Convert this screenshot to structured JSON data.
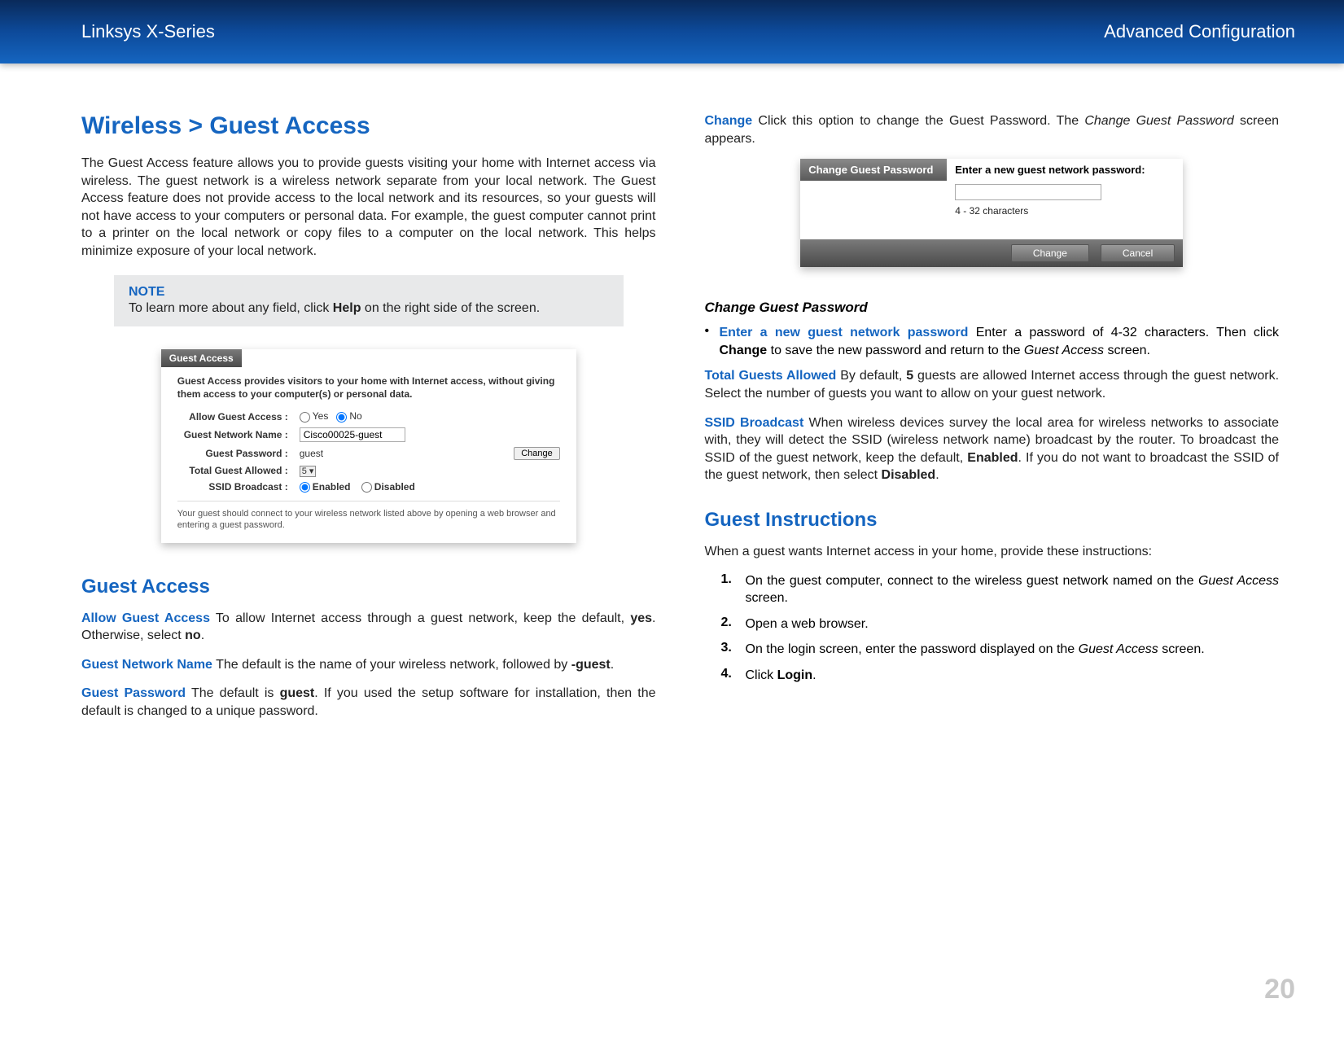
{
  "header": {
    "left": "Linksys X-Series",
    "right": "Advanced Configuration"
  },
  "left_col": {
    "h1": "Wireless > Guest Access",
    "intro": "The Guest Access feature allows you to provide guests visiting your home with Internet access via wireless. The guest network is a wireless network separate from your local network. The Guest Access feature does not provide access to the local network and its resources, so your guests will not have access to your computers or personal data. For example, the guest computer cannot print to a printer on the local network or copy files to a computer on the local network. This helps minimize exposure of your local network.",
    "note": {
      "title": "NOTE",
      "text_pre": "To learn more about any field, click ",
      "text_bold": "Help",
      "text_post": " on the right side of the screen."
    },
    "figure1": {
      "tab": "Guest Access",
      "intro": "Guest Access provides visitors to your home with Internet access, without giving them access to your computer(s) or personal data.",
      "rows": {
        "allow_label": "Allow Guest Access :",
        "allow_yes": "Yes",
        "allow_no": "No",
        "name_label": "Guest Network Name :",
        "name_value": "Cisco00025-guest",
        "pwd_label": "Guest Password :",
        "pwd_value": "guest",
        "change_btn": "Change",
        "total_label": "Total Guest Allowed :",
        "total_value": "5",
        "ssid_label": "SSID Broadcast :",
        "ssid_enabled": "Enabled",
        "ssid_disabled": "Disabled"
      },
      "footnote": "Your guest should connect to your wireless network listed above by opening a web browser and entering a guest password."
    },
    "h2": "Guest Access",
    "p_allow": {
      "term": "Allow Guest Access",
      "t1": "  To allow Internet access through a guest network, keep the default, ",
      "b1": "yes",
      "t2": ". Otherwise, select ",
      "b2": "no",
      "t3": "."
    },
    "p_name": {
      "term": "Guest Network Name",
      "t1": "  The default is the name of your wireless network, followed by ",
      "b1": "-guest",
      "t2": "."
    },
    "p_pwd": {
      "term": "Guest Password",
      "t1": "  The default is ",
      "b1": "guest",
      "t2": ". If you used the setup software for installation, then the default is changed to a unique password."
    }
  },
  "right_col": {
    "p_change": {
      "term": "Change",
      "t1": "  Click this option to change the Guest Password. The ",
      "i1": "Change Guest Password",
      "t2": " screen appears."
    },
    "dialog": {
      "title": "Change Guest Password",
      "prompt": "Enter a new guest network password:",
      "sub": "4 - 32 characters",
      "btn_change": "Change",
      "btn_cancel": "Cancel"
    },
    "subhead": "Change Guest Password",
    "bullet": {
      "term": "Enter a new guest network password",
      "t1": "   Enter a password of 4-32 characters. Then click ",
      "b1": "Change",
      "t2": " to save the new password and return to the ",
      "i1": "Guest Access",
      "t3": " screen."
    },
    "p_total": {
      "term": "Total Guests Allowed",
      "t1": "   By default, ",
      "b1": "5",
      "t2": " guests are allowed Internet access through the guest network. Select the number of guests you want to allow on your guest network."
    },
    "p_ssid": {
      "term": "SSID Broadcast",
      "t1": "  When wireless devices survey the local area for wireless networks to associate with, they will detect the SSID (wireless network name) broadcast by the router. To broadcast the SSID of the guest network, keep the default, ",
      "b1": "Enabled",
      "t2": ". If you do not want to broadcast the SSID of the guest network, then select ",
      "b2": "Disabled",
      "t3": "."
    },
    "h2": "Guest Instructions",
    "instr_intro": "When a guest wants Internet access in your home, provide these instructions:",
    "steps": {
      "s1": {
        "n": "1.",
        "t1": "On the guest computer, connect to the wireless guest network named on the ",
        "i1": "Guest Access",
        "t2": " screen."
      },
      "s2": {
        "n": "2.",
        "t1": "Open a web browser."
      },
      "s3": {
        "n": "3.",
        "t1": "On the login screen, enter the password displayed on the ",
        "i1": "Guest Access",
        "t2": " screen."
      },
      "s4": {
        "n": "4.",
        "t1": "Click ",
        "b1": "Login",
        "t2": "."
      }
    }
  },
  "page_number": "20"
}
